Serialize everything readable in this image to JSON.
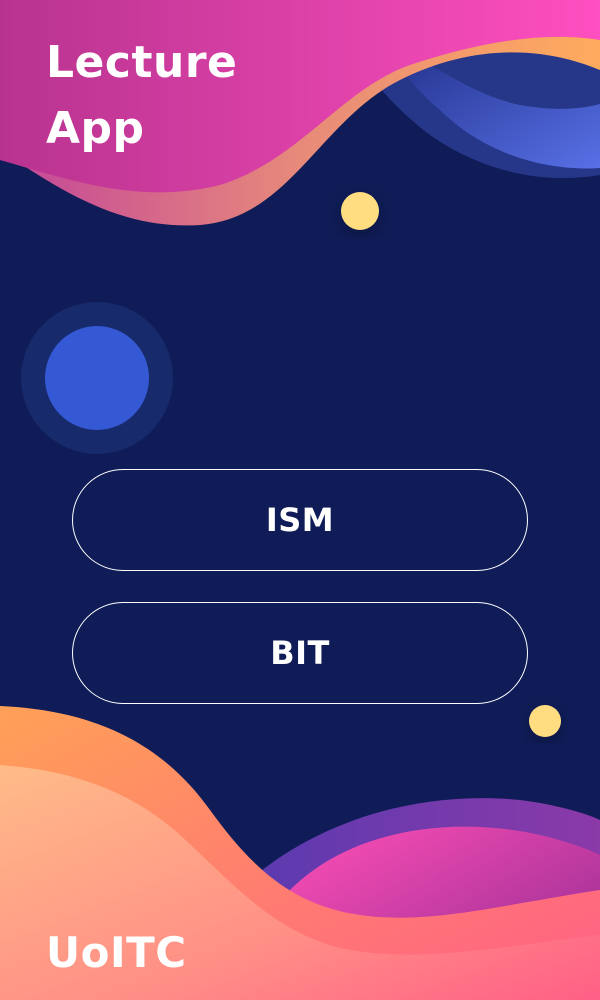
{
  "app": {
    "title_line1": "Lecture",
    "title_line2": "App",
    "footer": "UoITC"
  },
  "menu": {
    "buttons": [
      {
        "label": "ISM"
      },
      {
        "label": "BIT"
      }
    ]
  },
  "colors": {
    "background": "#0f1c57",
    "pink": "#e84bb5",
    "orange": "#ffa95c",
    "blue_circle": "#3558d4",
    "yellow_dot": "#ffdd80",
    "text": "#ffffff"
  }
}
